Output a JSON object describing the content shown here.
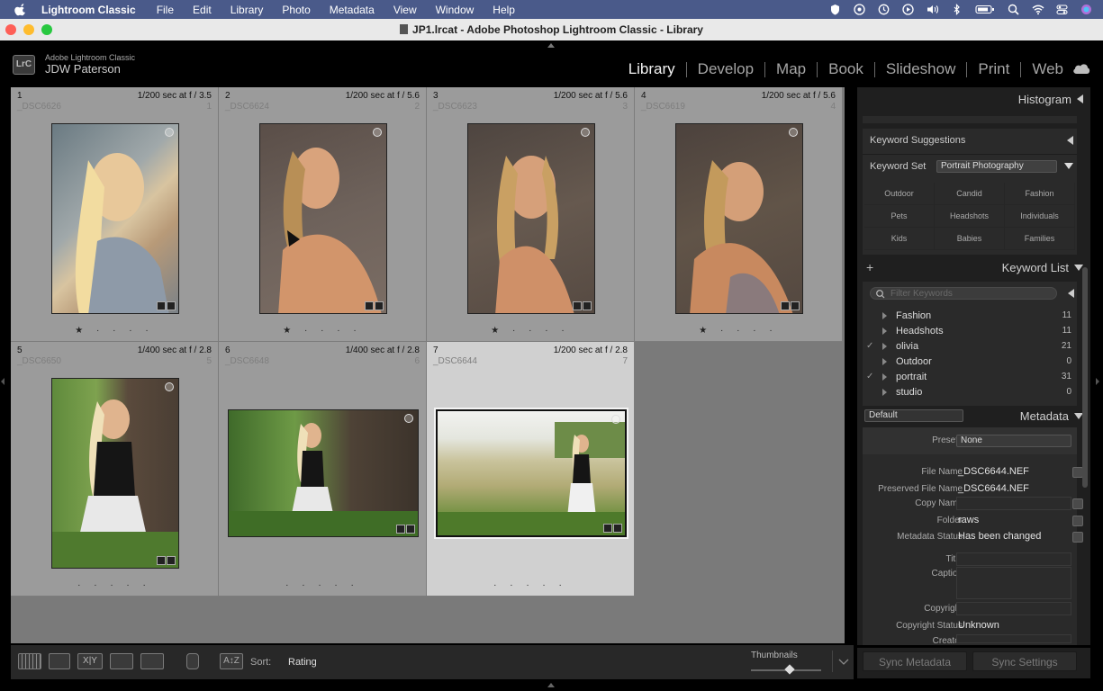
{
  "menubar": {
    "app": "Lightroom Classic",
    "items": [
      "File",
      "Edit",
      "Library",
      "Photo",
      "Metadata",
      "View",
      "Window",
      "Help"
    ],
    "status_icons": [
      "shield-icon",
      "vpn-icon",
      "time-machine-icon",
      "play-icon",
      "volume-icon",
      "bluetooth-icon",
      "battery-icon",
      "spotlight-icon",
      "wifi-icon",
      "control-center-icon",
      "siri-icon"
    ]
  },
  "window": {
    "title": "JP1.lrcat - Adobe Photoshop Lightroom Classic - Library"
  },
  "identity": {
    "logo": "LrC",
    "product": "Adobe Lightroom Classic",
    "user": "JDW Paterson"
  },
  "modules": [
    {
      "label": "Library",
      "active": true
    },
    {
      "label": "Develop",
      "active": false
    },
    {
      "label": "Map",
      "active": false
    },
    {
      "label": "Book",
      "active": false
    },
    {
      "label": "Slideshow",
      "active": false
    },
    {
      "label": "Print",
      "active": false
    },
    {
      "label": "Web",
      "active": false
    }
  ],
  "grid": [
    {
      "index": "1",
      "exif": "1/200 sec at f / 3.5",
      "filename": "_DSC6626",
      "num": "1",
      "rating": "★ · · · ·",
      "orientation": "portrait",
      "selected": false
    },
    {
      "index": "2",
      "exif": "1/200 sec at f / 5.6",
      "filename": "_DSC6624",
      "num": "2",
      "rating": "★ · · · ·",
      "orientation": "portrait",
      "selected": false
    },
    {
      "index": "3",
      "exif": "1/200 sec at f / 5.6",
      "filename": "_DSC6623",
      "num": "3",
      "rating": "★ · · · ·",
      "orientation": "portrait",
      "selected": false
    },
    {
      "index": "4",
      "exif": "1/200 sec at f / 5.6",
      "filename": "_DSC6619",
      "num": "4",
      "rating": "★ · · · ·",
      "orientation": "portrait",
      "selected": false
    },
    {
      "index": "5",
      "exif": "1/400 sec at f / 2.8",
      "filename": "_DSC6650",
      "num": "5",
      "rating": "· · · · ·",
      "orientation": "portrait",
      "selected": false
    },
    {
      "index": "6",
      "exif": "1/400 sec at f / 2.8",
      "filename": "_DSC6648",
      "num": "6",
      "rating": "· · · · ·",
      "orientation": "landscape",
      "selected": false
    },
    {
      "index": "7",
      "exif": "1/200 sec at f / 2.8",
      "filename": "_DSC6644",
      "num": "7",
      "rating": "· · · · ·",
      "orientation": "landscape",
      "selected": true
    }
  ],
  "toolbar": {
    "sort_label": "Sort:",
    "sort_value": "Rating",
    "thumbnails_label": "Thumbnails",
    "thumbnail_size": 0.55,
    "view_buttons": [
      "grid-view-icon",
      "loupe-view-icon",
      "compare-view-icon",
      "survey-view-icon",
      "people-view-icon"
    ]
  },
  "panels": {
    "histogram": "Histogram",
    "keyword_suggestions": "Keyword Suggestions",
    "keyword_set_label": "Keyword Set",
    "keyword_set_value": "Portrait Photography",
    "keyword_set_buttons": [
      "Outdoor",
      "Candid",
      "Fashion",
      "Pets",
      "Headshots",
      "Individuals",
      "Kids",
      "Babies",
      "Families"
    ],
    "keyword_list": "Keyword List",
    "filter_placeholder": "Filter Keywords",
    "keywords": [
      {
        "name": "Fashion",
        "count": "11",
        "checked": false
      },
      {
        "name": "Headshots",
        "count": "11",
        "checked": false
      },
      {
        "name": "olivia",
        "count": "21",
        "checked": true
      },
      {
        "name": "Outdoor",
        "count": "0",
        "checked": false
      },
      {
        "name": "portrait",
        "count": "31",
        "checked": true
      },
      {
        "name": "studio",
        "count": "0",
        "checked": false
      }
    ],
    "metadata": "Metadata",
    "metadata_view": "Default",
    "preset_label": "Preset",
    "preset_value": "None",
    "file_name_label": "File Name",
    "file_name_value": "_DSC6644.NEF",
    "preserved_label": "Preserved File Name",
    "preserved_value": "_DSC6644.NEF",
    "copy_name_label": "Copy Name",
    "folder_label": "Folder",
    "folder_value": "raws",
    "status_label": "Metadata Status",
    "status_value": "Has been changed",
    "title_label": "Title",
    "caption_label": "Caption",
    "copyright_label": "Copyright",
    "copyright_status_label": "Copyright Status",
    "copyright_status_value": "Unknown",
    "creator_label": "Creator",
    "sync_metadata": "Sync Metadata",
    "sync_settings": "Sync Settings"
  }
}
